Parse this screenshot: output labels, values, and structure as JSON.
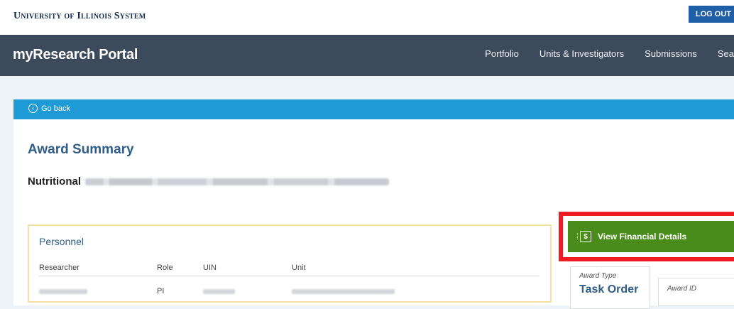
{
  "header": {
    "university": "University of Illinois System",
    "logout_label": "LOG OUT"
  },
  "portal": {
    "title": "myResearch Portal",
    "nav": [
      "Portfolio",
      "Units & Investigators",
      "Submissions",
      "Search"
    ]
  },
  "goback": {
    "label": "Go back"
  },
  "award": {
    "heading": "Award Summary",
    "project_title_visible": "Nutritional"
  },
  "personnel": {
    "title": "Personnel",
    "columns": [
      "Researcher",
      "Role",
      "UIN",
      "Unit"
    ],
    "rows": [
      {
        "role": "PI"
      }
    ]
  },
  "financial": {
    "button_label": "View Financial Details"
  },
  "details": {
    "award_type_label": "Award Type",
    "award_type_value": "Task Order",
    "award_id_label": "Award ID"
  },
  "colors": {
    "nav_bg": "#3c4a5c",
    "goback_bg": "#1e9ad6",
    "financial_button": "#4a8c1c",
    "highlight": "#ee1c23"
  }
}
